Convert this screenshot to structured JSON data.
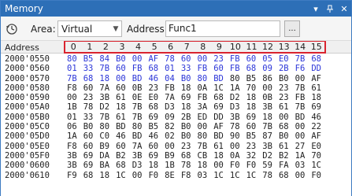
{
  "window": {
    "title": "Memory"
  },
  "toolbar": {
    "area_label": "Area:",
    "area_value": "Virtual",
    "address_label": "Address:",
    "address_value": "Func1",
    "more_label": "..."
  },
  "grid": {
    "address_header": "Address",
    "columns": [
      "0",
      "1",
      "2",
      "3",
      "4",
      "5",
      "6",
      "7",
      "8",
      "9",
      "10",
      "11",
      "12",
      "13",
      "14",
      "15"
    ],
    "rows": [
      {
        "address": "2000'0550",
        "bytes": [
          "80",
          "B5",
          "84",
          "B0",
          "00",
          "AF",
          "78",
          "60",
          "00",
          "23",
          "FB",
          "60",
          "05",
          "E0",
          "7B",
          "68"
        ],
        "blue_count": 16
      },
      {
        "address": "2000'0560",
        "bytes": [
          "01",
          "33",
          "7B",
          "60",
          "FB",
          "68",
          "01",
          "33",
          "FB",
          "60",
          "FB",
          "68",
          "09",
          "2B",
          "F6",
          "DD"
        ],
        "blue_count": 16
      },
      {
        "address": "2000'0570",
        "bytes": [
          "7B",
          "68",
          "18",
          "00",
          "BD",
          "46",
          "04",
          "B0",
          "80",
          "BD",
          "80",
          "B5",
          "86",
          "B0",
          "00",
          "AF"
        ],
        "blue_count": 10
      },
      {
        "address": "2000'0580",
        "bytes": [
          "F8",
          "60",
          "7A",
          "60",
          "0B",
          "23",
          "FB",
          "18",
          "0A",
          "1C",
          "1A",
          "70",
          "00",
          "23",
          "7B",
          "61"
        ],
        "blue_count": 0
      },
      {
        "address": "2000'0590",
        "bytes": [
          "00",
          "23",
          "3B",
          "61",
          "0E",
          "E0",
          "7A",
          "69",
          "FB",
          "68",
          "D2",
          "18",
          "0B",
          "23",
          "FB",
          "18"
        ],
        "blue_count": 0
      },
      {
        "address": "2000'05A0",
        "bytes": [
          "1B",
          "78",
          "D2",
          "18",
          "7B",
          "68",
          "D3",
          "18",
          "3A",
          "69",
          "D3",
          "18",
          "3B",
          "61",
          "7B",
          "69"
        ],
        "blue_count": 0
      },
      {
        "address": "2000'05B0",
        "bytes": [
          "01",
          "33",
          "7B",
          "61",
          "7B",
          "69",
          "09",
          "2B",
          "ED",
          "DD",
          "3B",
          "69",
          "18",
          "00",
          "BD",
          "46"
        ],
        "blue_count": 0
      },
      {
        "address": "2000'05C0",
        "bytes": [
          "06",
          "B0",
          "80",
          "BD",
          "80",
          "B5",
          "82",
          "B0",
          "00",
          "AF",
          "78",
          "60",
          "7B",
          "68",
          "00",
          "22"
        ],
        "blue_count": 0
      },
      {
        "address": "2000'05D0",
        "bytes": [
          "1A",
          "60",
          "C0",
          "46",
          "BD",
          "46",
          "02",
          "B0",
          "80",
          "BD",
          "90",
          "B5",
          "87",
          "B0",
          "00",
          "AF"
        ],
        "blue_count": 0
      },
      {
        "address": "2000'05E0",
        "bytes": [
          "F8",
          "60",
          "B9",
          "60",
          "7A",
          "60",
          "00",
          "23",
          "7B",
          "61",
          "00",
          "23",
          "3B",
          "61",
          "27",
          "E0"
        ],
        "blue_count": 0
      },
      {
        "address": "2000'05F0",
        "bytes": [
          "3B",
          "69",
          "DA",
          "B2",
          "3B",
          "69",
          "B9",
          "68",
          "CB",
          "18",
          "0A",
          "32",
          "D2",
          "B2",
          "1A",
          "70"
        ],
        "blue_count": 0
      },
      {
        "address": "2000'0600",
        "bytes": [
          "3B",
          "69",
          "BA",
          "68",
          "D3",
          "18",
          "1B",
          "78",
          "18",
          "00",
          "F0",
          "F0",
          "59",
          "FA",
          "03",
          "1C"
        ],
        "blue_count": 0
      },
      {
        "address": "2000'0610",
        "bytes": [
          "F9",
          "68",
          "18",
          "1C",
          "00",
          "F0",
          "8E",
          "F8",
          "03",
          "1C",
          "1C",
          "1C",
          "78",
          "68",
          "00",
          "F0"
        ],
        "blue_count": 0
      }
    ]
  },
  "colors": {
    "titlebar": "#2d6fb7",
    "highlight_border": "#d9242f",
    "code_bytes": "#2b35d8"
  }
}
